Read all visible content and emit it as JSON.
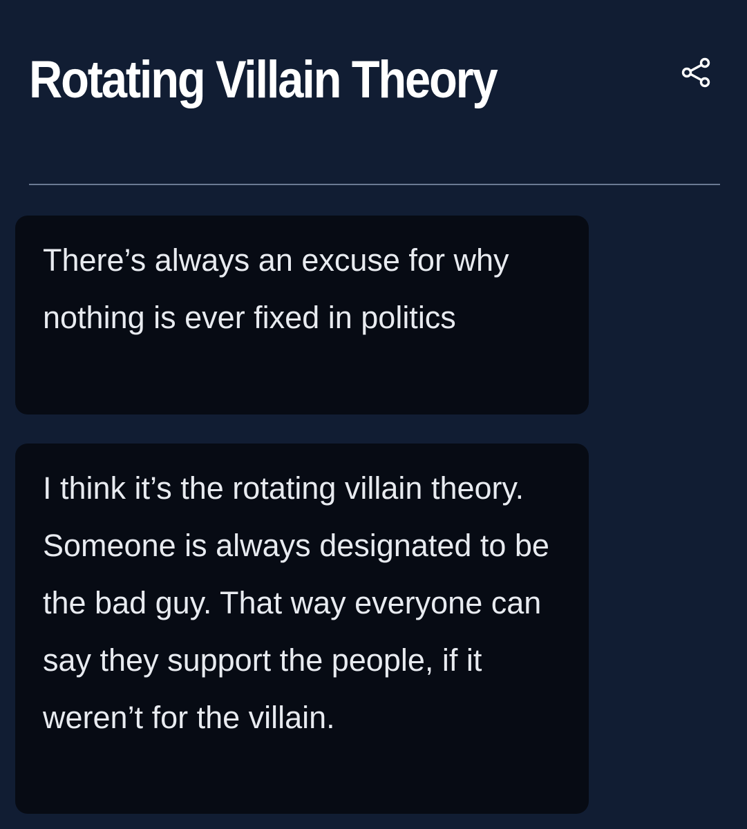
{
  "header": {
    "title": "Rotating Villain Theory",
    "share_icon": "share-icon"
  },
  "messages": [
    {
      "text": "There’s always an excuse for why nothing is ever fixed in politics"
    },
    {
      "text": "I think it’s the rotating villain theory. Someone is always designated to be the bad guy. That way everyone can say they support the people, if it weren’t for the villain."
    }
  ],
  "colors": {
    "background": "#111d33",
    "card": "#070b14",
    "title": "#ffffff",
    "text": "#e8ebf0",
    "divider": "#6b7a93"
  }
}
